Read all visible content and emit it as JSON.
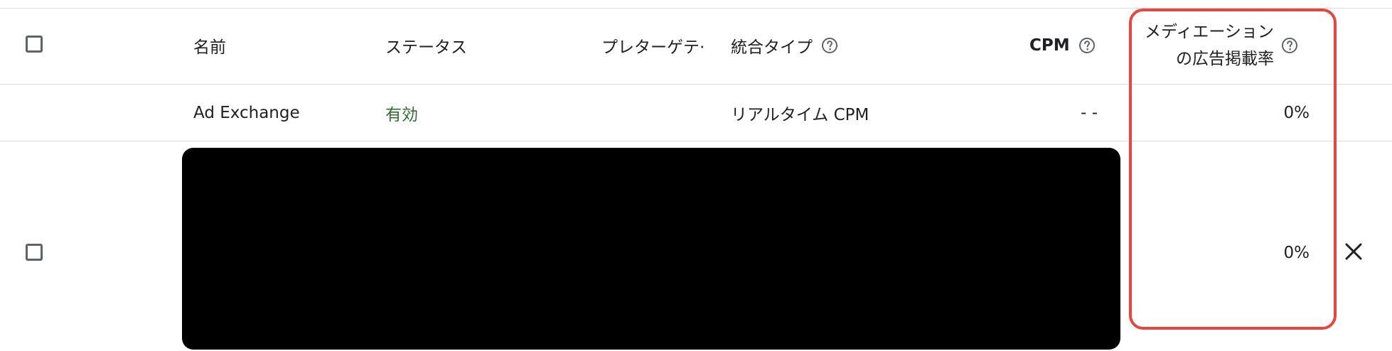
{
  "header": {
    "name": "名前",
    "status": "ステータス",
    "prebid_target": "プレターゲテ·",
    "integration_type": "統合タイプ",
    "cpm": "CPM",
    "mediation_line1": "メディエーション",
    "mediation_line2": "の広告掲載率"
  },
  "rows": [
    {
      "name": "Ad Exchange",
      "status": "有効",
      "integration_type": "リアルタイム CPM",
      "cpm": "- -",
      "mediation_rate": "0%"
    },
    {
      "mediation_rate": "0%"
    }
  ],
  "colors": {
    "status_active": "#2f6e2f",
    "highlight": "#e8453c",
    "divider": "#dadce0"
  },
  "icons": {
    "help": "help-circle-icon",
    "close": "close-icon"
  }
}
